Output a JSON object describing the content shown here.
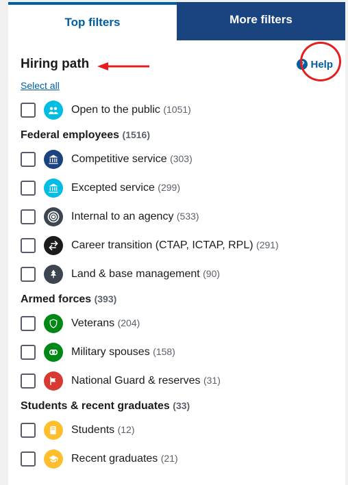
{
  "tabs": {
    "top": "Top filters",
    "more": "More filters"
  },
  "title": "Hiring path",
  "help": "Help",
  "select_all": "Select all",
  "open_public": {
    "label": "Open to the public",
    "count": "(1051)"
  },
  "federal": {
    "head": "Federal employees",
    "head_count": "(1516)",
    "items": [
      {
        "label": "Competitive service",
        "count": "(303)"
      },
      {
        "label": "Excepted service",
        "count": "(299)"
      },
      {
        "label": "Internal to an agency",
        "count": "(533)"
      },
      {
        "label": "Career transition (CTAP, ICTAP, RPL)",
        "count": "(291)"
      },
      {
        "label": "Land & base management",
        "count": "(90)"
      }
    ]
  },
  "armed": {
    "head": "Armed forces",
    "head_count": "(393)",
    "items": [
      {
        "label": "Veterans",
        "count": "(204)"
      },
      {
        "label": "Military spouses",
        "count": "(158)"
      },
      {
        "label": "National Guard & reserves",
        "count": "(31)"
      }
    ]
  },
  "students": {
    "head": "Students & recent graduates",
    "head_count": "(33)",
    "items": [
      {
        "label": "Students",
        "count": "(12)"
      },
      {
        "label": "Recent graduates",
        "count": "(21)"
      }
    ]
  }
}
